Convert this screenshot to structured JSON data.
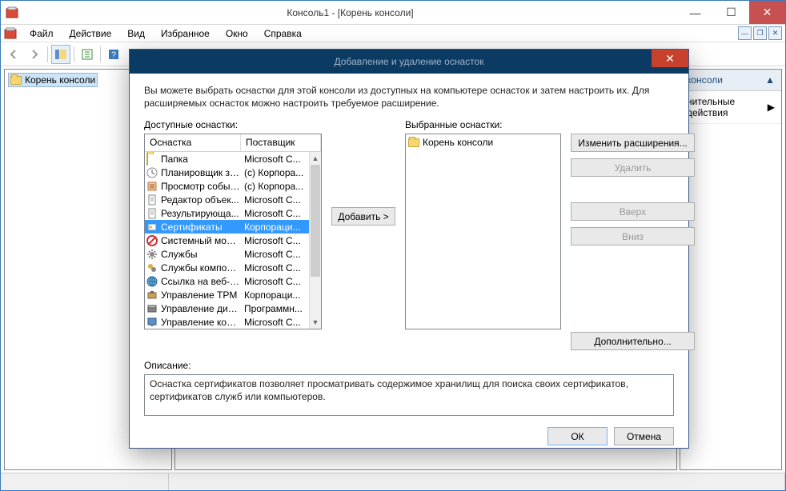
{
  "window": {
    "title": "Консоль1 - [Корень консоли]"
  },
  "menu": {
    "file": "Файл",
    "action": "Действие",
    "view": "Вид",
    "favorites": "Избранное",
    "window": "Окно",
    "help": "Справка"
  },
  "tree": {
    "root": "Корень консоли"
  },
  "actions": {
    "header": "консоли",
    "extra": "нительные действия"
  },
  "dialog": {
    "title": "Добавление и удаление оснасток",
    "intro": "Вы можете выбрать оснастки для этой консоли из доступных на компьютере оснасток и затем настроить их. Для расширяемых оснасток можно настроить требуемое расширение.",
    "available_label": "Доступные оснастки:",
    "selected_label": "Выбранные оснастки:",
    "col_name": "Оснастка",
    "col_vendor": "Поставщик",
    "add_btn": "Добавить >",
    "change_ext": "Изменить расширения...",
    "delete": "Удалить",
    "up": "Вверх",
    "down": "Вниз",
    "advanced": "Дополнительно...",
    "desc_label": "Описание:",
    "desc_text": "Оснастка сертификатов позволяет просматривать содержимое хранилищ для поиска своих сертификатов, сертификатов служб или компьютеров.",
    "ok": "ОК",
    "cancel": "Отмена",
    "snapins": [
      {
        "name": "Папка",
        "vendor": "Microsoft C...",
        "icon": "folder"
      },
      {
        "name": "Планировщик за...",
        "vendor": "(с) Корпора...",
        "icon": "clock"
      },
      {
        "name": "Просмотр событий",
        "vendor": "(с) Корпора...",
        "icon": "event"
      },
      {
        "name": "Редактор объек...",
        "vendor": "Microsoft C...",
        "icon": "doc"
      },
      {
        "name": "Результирующа...",
        "vendor": "Microsoft C...",
        "icon": "doc"
      },
      {
        "name": "Сертификаты",
        "vendor": "Корпораци...",
        "icon": "cert",
        "selected": true
      },
      {
        "name": "Системный мони...",
        "vendor": "Microsoft C...",
        "icon": "stop"
      },
      {
        "name": "Службы",
        "vendor": "Microsoft C...",
        "icon": "gear"
      },
      {
        "name": "Службы компоне...",
        "vendor": "Microsoft C...",
        "icon": "gear2"
      },
      {
        "name": "Ссылка на веб-р...",
        "vendor": "Microsoft C...",
        "icon": "globe"
      },
      {
        "name": "Управление TPM",
        "vendor": "Корпораци...",
        "icon": "tpm"
      },
      {
        "name": "Управление диск...",
        "vendor": "Программн...",
        "icon": "disk"
      },
      {
        "name": "Управление комп...",
        "vendor": "Microsoft C...",
        "icon": "pc"
      }
    ],
    "selected_root": "Корень консоли"
  }
}
